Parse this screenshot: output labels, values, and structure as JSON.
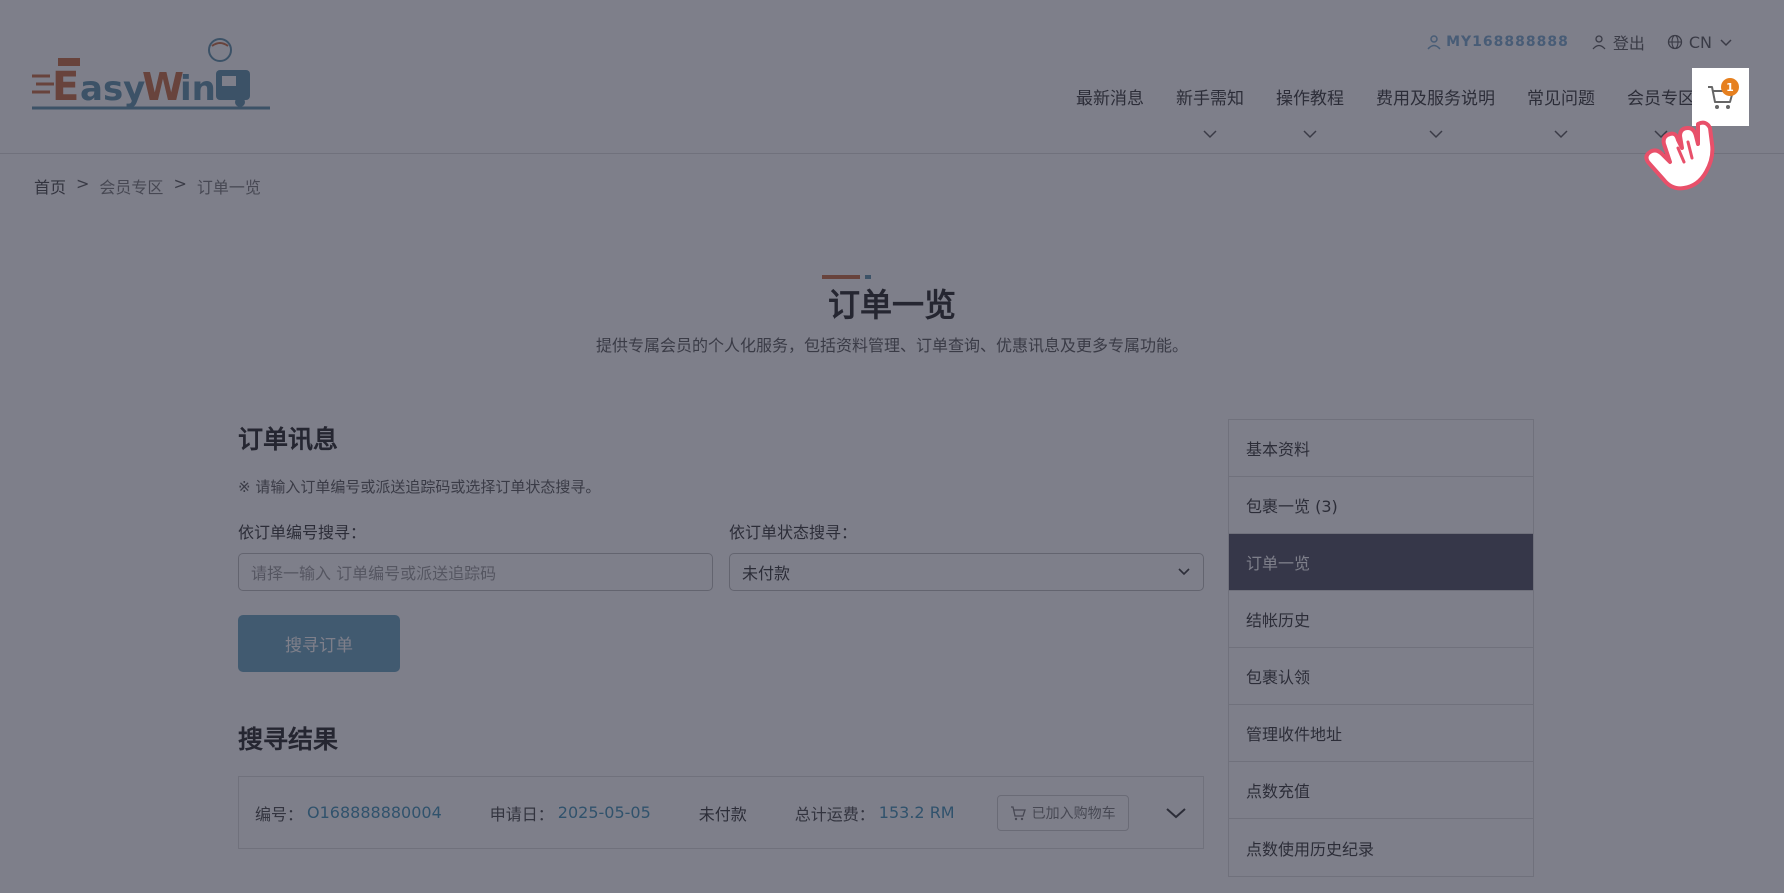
{
  "header": {
    "user_id": "MY168888888",
    "logout_label": "登出",
    "lang_label": "CN",
    "nav": [
      "最新消息",
      "新手需知",
      "操作教程",
      "费用及服务说明",
      "常见问题",
      "会员专区"
    ],
    "cart_count": "1"
  },
  "breadcrumb": [
    "首页",
    "会员专区",
    "订单一览"
  ],
  "page": {
    "title": "订单一览",
    "subtitle": "提供专属会员的个人化服务，包括资料管理、订单查询、优惠讯息及更多专属功能。"
  },
  "order_search": {
    "title": "订单讯息",
    "note": "※ 请输入订单编号或派送追踪码或选择订单状态搜寻。",
    "order_no_label": "依订单编号搜寻：",
    "order_no_placeholder": "请择一输入 订单编号或派送追踪码",
    "status_label": "依订单状态搜寻：",
    "status_selected": "未付款",
    "search_button": "搜寻订单"
  },
  "results": {
    "title": "搜寻结果",
    "rows": [
      {
        "no_label": "编号：",
        "no": "O168888880004",
        "date_label": "申请日：",
        "date": "2025-05-05",
        "status": "未付款",
        "fee_label": "总计运费：",
        "fee": "153.2 RM",
        "cart_label": "已加入购物车"
      }
    ]
  },
  "sidebar": {
    "items": [
      "基本资料",
      "包裹一览 (3)",
      "订单一览",
      "结帐历史",
      "包裹认领",
      "管理收件地址",
      "点数充值",
      "点数使用历史纪录"
    ],
    "active_index": 2
  },
  "colors": {
    "accent": "#67a2bd",
    "brand_orange": "#e6801f",
    "sidebar_active": "#4b4c5e",
    "link": "#3d8fb5"
  }
}
